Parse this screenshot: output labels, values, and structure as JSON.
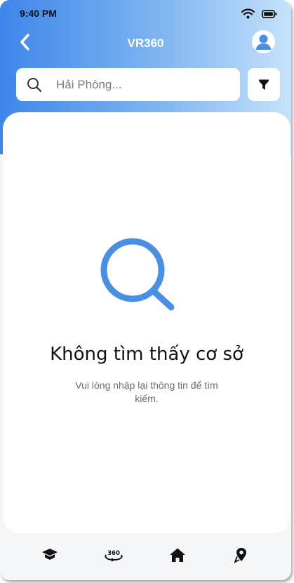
{
  "status_bar": {
    "time": "9:40 PM",
    "icons": [
      "wifi-icon",
      "battery-icon"
    ]
  },
  "top_bar": {
    "title": "VR360",
    "back_icon": "chevron-left-icon",
    "avatar_icon": "user-avatar-icon"
  },
  "search": {
    "placeholder": "Hải Phòng...",
    "value": "",
    "icon": "search-icon",
    "filter_icon": "filter-icon"
  },
  "empty_state": {
    "icon": "magnifier-icon",
    "title": "Không tìm thấy cơ sở",
    "message": "Vui lòng nhập lại thông tin để tìm kiếm."
  },
  "bottom_nav": {
    "items": [
      {
        "icon": "graduation-cap-icon"
      },
      {
        "icon": "vr360-icon"
      },
      {
        "icon": "home-icon"
      },
      {
        "icon": "map-pin-icon"
      }
    ]
  },
  "colors": {
    "header_gradient_start": "#3f86ea",
    "header_gradient_end": "#c6e2fb",
    "accent": "#4a90e2"
  }
}
